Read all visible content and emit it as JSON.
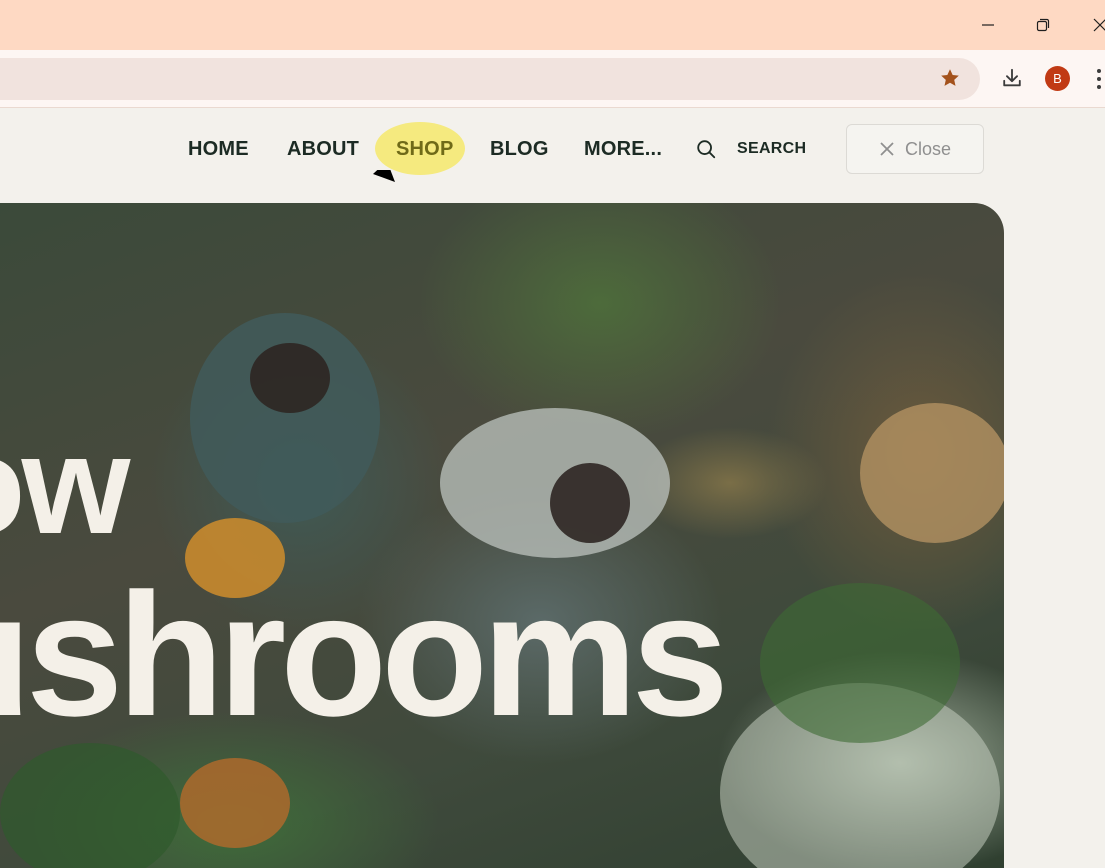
{
  "browser": {
    "window_controls": {
      "minimize_icon": "minimize-icon",
      "maximize_icon": "restore-icon",
      "close_icon": "close-icon"
    },
    "toolbar": {
      "bookmark_icon": "star-icon",
      "download_icon": "download-icon",
      "profile_initial": "B",
      "menu_icon": "kebab-menu-icon",
      "profile_color": "#c13a14",
      "star_color": "#a4521c"
    }
  },
  "nav": {
    "items": [
      {
        "label": "HOME"
      },
      {
        "label": "ABOUT"
      },
      {
        "label": "SHOP",
        "highlighted": true
      },
      {
        "label": "BLOG"
      },
      {
        "label": "MORE..."
      }
    ],
    "search_label": "SEARCH",
    "close_label": "Close",
    "highlight_color": "#f5ea7f"
  },
  "hero": {
    "line1": "ow",
    "line2": "ushrooms"
  }
}
